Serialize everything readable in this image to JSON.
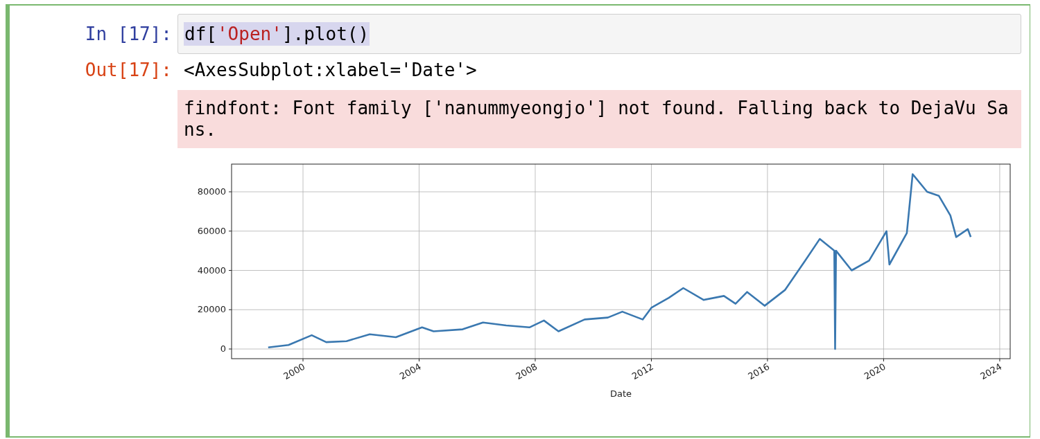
{
  "cell": {
    "selected": true,
    "input_prompt": "In [17]:",
    "code": [
      {
        "kind": "plain",
        "text": "df["
      },
      {
        "kind": "string",
        "text": "'Open'"
      },
      {
        "kind": "plain",
        "text": "].plot()"
      }
    ],
    "code_selected": true,
    "output_prompt": "Out[17]:",
    "output_text": "<AxesSubplot:xlabel='Date'>",
    "stderr": "findfont: Font family ['nanummyeongjo'] not found. Falling back to DejaVu Sans.",
    "chart_data": {
      "type": "line",
      "xlabel": "Date",
      "x": [
        1998.8,
        1999.5,
        2000.3,
        2000.8,
        2001.5,
        2002.3,
        2003.2,
        2004.1,
        2004.5,
        2005.5,
        2006.2,
        2007.0,
        2007.8,
        2008.3,
        2008.8,
        2009.7,
        2010.5,
        2011.0,
        2011.7,
        2012.0,
        2012.6,
        2013.1,
        2013.8,
        2014.5,
        2014.9,
        2015.3,
        2015.9,
        2016.6,
        2017.3,
        2017.8,
        2018.3,
        2018.33,
        2018.36,
        2018.9,
        2019.5,
        2020.1,
        2020.2,
        2020.8,
        2021.0,
        2021.5,
        2021.9,
        2022.3,
        2022.5,
        2022.9,
        2023.0
      ],
      "series": [
        {
          "color": "#3a78b0",
          "values": [
            800,
            2000,
            7000,
            3500,
            4000,
            7500,
            6000,
            11000,
            9000,
            10000,
            13500,
            12000,
            11000,
            14500,
            9000,
            15000,
            16000,
            19000,
            15000,
            21000,
            26000,
            31000,
            25000,
            27000,
            23000,
            29000,
            22000,
            30000,
            45000,
            56000,
            50000,
            0,
            50000,
            40000,
            45000,
            60000,
            43000,
            59000,
            89000,
            80000,
            78000,
            68000,
            57000,
            61000,
            57000
          ]
        }
      ],
      "grid": true,
      "xlim": [
        1997.54,
        2024.36
      ],
      "ylim": [
        -4930,
        94100
      ],
      "xticks": [
        2000,
        2004,
        2008,
        2012,
        2016,
        2020,
        2024
      ],
      "yticks": [
        0,
        20000,
        40000,
        60000,
        80000
      ]
    }
  }
}
